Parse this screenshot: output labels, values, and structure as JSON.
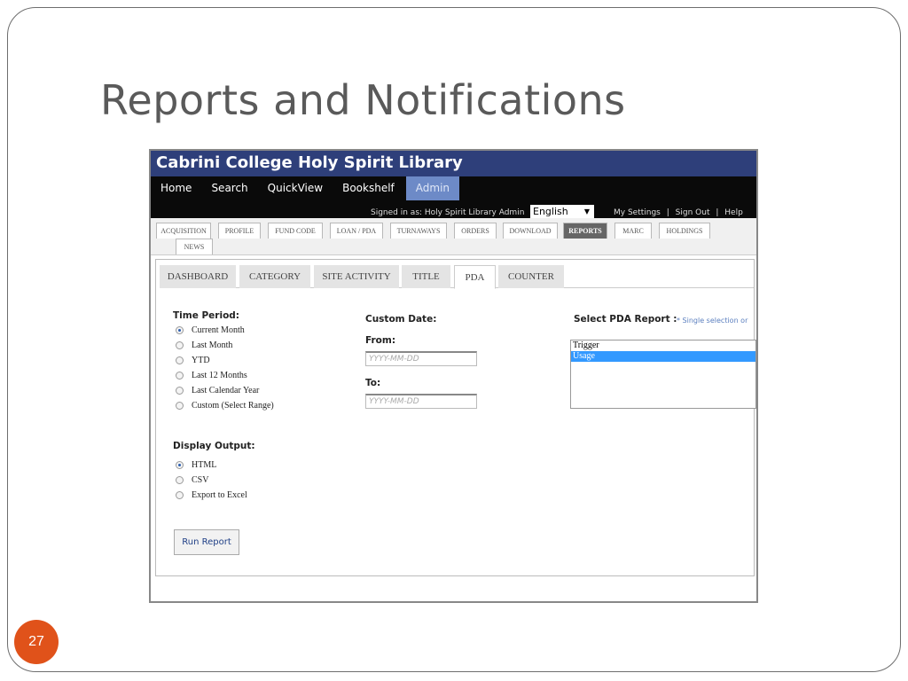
{
  "slide": {
    "title": "Reports and Notifications",
    "page_number": "27"
  },
  "app": {
    "library_name": "Cabrini College  Holy Spirit Library",
    "nav": [
      "Home",
      "Search",
      "QuickView",
      "Bookshelf",
      "Admin"
    ],
    "active_nav": "Admin",
    "signed_in": "Signed in as: Holy Spirit Library Admin",
    "language": "English",
    "top_links": [
      "My Settings",
      "|",
      "Sign Out",
      "|",
      "Help"
    ]
  },
  "module_tabs": [
    "ACQUISITION",
    "PROFILE",
    "FUND CODE",
    "LOAN / PDA",
    "TURNAWAYS",
    "ORDERS",
    "DOWNLOAD",
    "REPORTS",
    "MARC",
    "HOLDINGS",
    "NEWS"
  ],
  "active_module_tab": "REPORTS",
  "sub_tabs": [
    "DASHBOARD",
    "CATEGORY",
    "SITE ACTIVITY",
    "TITLE",
    "PDA",
    "COUNTER"
  ],
  "active_sub_tab": "PDA",
  "time_period": {
    "label": "Time Period:",
    "options": [
      "Current Month",
      "Last Month",
      "YTD",
      "Last 12 Months",
      "Last Calendar Year",
      "Custom (Select Range)"
    ],
    "selected": "Current Month"
  },
  "custom_date": {
    "label": "Custom Date:",
    "from_label": "From:",
    "to_label": "To:",
    "placeholder": "YYYY-MM-DD"
  },
  "pda_report": {
    "label": "Select PDA Report :",
    "hint": "* Single selection or",
    "options": [
      "Trigger",
      "Usage"
    ],
    "selected": "Usage"
  },
  "display_output": {
    "label": "Display Output:",
    "options": [
      "HTML",
      "CSV",
      "Export to Excel"
    ],
    "selected": "HTML"
  },
  "run_button": "Run Report",
  "colors": {
    "header_blue": "#2e3f7a",
    "nav_black": "#0a0a0a",
    "admin_active": "#6d8ac7",
    "page_badge": "#e0521a",
    "selection_blue": "#3399ff"
  }
}
